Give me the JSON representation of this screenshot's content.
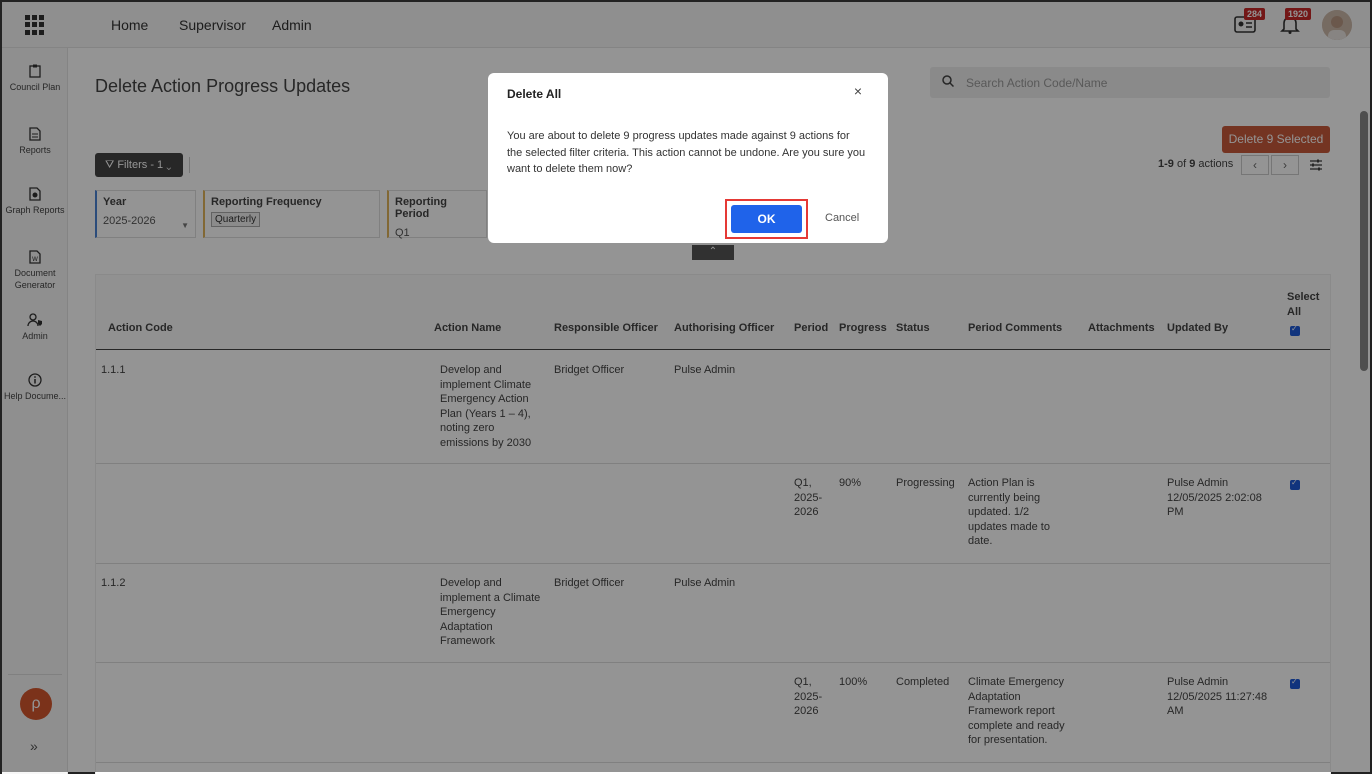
{
  "topbar": {
    "nav": [
      "Home",
      "Supervisor",
      "Admin"
    ],
    "badges": {
      "tasks_count": "284",
      "notifications_count": "1920"
    }
  },
  "sidebar": {
    "items": [
      {
        "label": "Council Plan",
        "icon": "clipboard-icon"
      },
      {
        "label": "Reports",
        "icon": "document-icon"
      },
      {
        "label": "Graph Reports",
        "icon": "graph-document-icon"
      },
      {
        "label": "Document Generator",
        "icon": "word-document-icon"
      },
      {
        "label": "Admin",
        "icon": "user-shield-icon"
      },
      {
        "label": "Help Docume...",
        "icon": "info-icon"
      }
    ],
    "logo": "ρ",
    "expand": "»"
  },
  "page": {
    "title": "Delete Action Progress Updates",
    "search_placeholder": "Search Action Code/Name",
    "delete_button": "Delete 9 Selected",
    "filters_button": "Filters - 1",
    "pager": {
      "range": "1-9",
      "of": "of",
      "total": "9",
      "unit": "actions"
    }
  },
  "filters": [
    {
      "label": "Year",
      "value": "2025-2026"
    },
    {
      "label": "Reporting Frequency",
      "value": "Quarterly"
    },
    {
      "label": "Reporting Period",
      "value": "Q1"
    }
  ],
  "table": {
    "columns": [
      "Action Code",
      "Action Name",
      "Responsible Officer",
      "Authorising Officer",
      "Period",
      "Progress",
      "Status",
      "Period Comments",
      "Attachments",
      "Updated By",
      "Select All"
    ],
    "rows": [
      {
        "code": "1.1.1",
        "name": "Develop and implement Climate Emergency Action Plan (Years 1 – 4), noting zero emissions by 2030",
        "responsible": "Bridget Officer",
        "authorising": "Pulse Admin"
      },
      {
        "period": "Q1, 2025-2026",
        "progress": "90%",
        "status": "Progressing",
        "comments": "Action Plan is currently being updated. 1/2 updates made to date.",
        "updated_by": "Pulse Admin 12/05/2025 2:02:08 PM"
      },
      {
        "code": "1.1.2",
        "name": "Develop and implement a Climate Emergency Adaptation Framework",
        "responsible": "Bridget Officer",
        "authorising": "Pulse Admin"
      },
      {
        "period": "Q1, 2025-2026",
        "progress": "100%",
        "status": "Completed",
        "comments": "Climate Emergency Adaptation Framework report complete and ready for presentation.",
        "updated_by": "Pulse Admin 12/05/2025 11:27:48 AM"
      }
    ]
  },
  "modal": {
    "title": "Delete All",
    "body": "You are about to delete 9 progress updates made against 9 actions for the selected filter criteria. This action cannot be undone. Are you sure you want to delete them now?",
    "ok": "OK",
    "cancel": "Cancel",
    "close": "×"
  },
  "colors": {
    "ok": "#1f63ea",
    "delete": "#c95a3b",
    "badge": "#c62828",
    "highlight": "#e53935"
  }
}
